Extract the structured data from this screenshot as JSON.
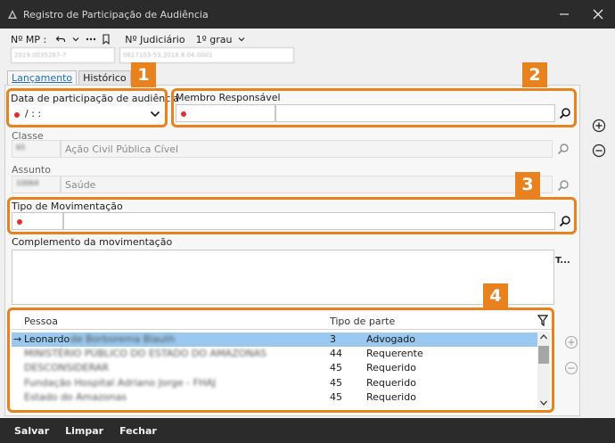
{
  "window": {
    "title": "Registro de Participação de Audiência"
  },
  "header": {
    "mp_label": "Nº MP :",
    "mp_value": "2019.0035287-7",
    "judiciario_label": "Nº Judiciário",
    "grau_label": "1º grau",
    "judiciario_value": "0617103-53.2018.8.04.0001"
  },
  "tabs": [
    "Lançamento",
    "Histórico"
  ],
  "form": {
    "data_label": "Data de participação de audiência",
    "data_value": "/     :  :",
    "membro_label": "Membro Responsável",
    "classe_label": "Classe",
    "classe_code": "65",
    "classe_value": "Ação Civil Pública Cível",
    "assunto_label": "Assunto",
    "assunto_code": "10064",
    "assunto_value": "Saúde",
    "tipo_label": "Tipo de Movimentação",
    "complemento_label": "Complemento da movimentação",
    "complemento_icon_text": "T..."
  },
  "badges": [
    "1",
    "2",
    "3",
    "4"
  ],
  "grid": {
    "columns": [
      "Pessoa",
      "Tipo de parte"
    ],
    "rows": [
      {
        "marker": "→",
        "pessoa": "Leonardo",
        "pessoa_blurred": "de Borborema Blauth",
        "code": "3",
        "tipo": "Advogado",
        "selected": true
      },
      {
        "marker": "",
        "pessoa": "",
        "pessoa_blurred": "MINISTÉRIO PÚBLICO DO ESTADO DO AMAZONAS",
        "code": "44",
        "tipo": "Requerente",
        "selected": false
      },
      {
        "marker": "",
        "pessoa": "",
        "pessoa_blurred": "DESCONSIDERAR",
        "code": "45",
        "tipo": "Requerido",
        "selected": false
      },
      {
        "marker": "",
        "pessoa": "",
        "pessoa_blurred": "Fundação Hospital Adriano Jorge - FHAJ",
        "code": "45",
        "tipo": "Requerido",
        "selected": false
      },
      {
        "marker": "",
        "pessoa": "",
        "pessoa_blurred": "Estado do Amazonas",
        "code": "45",
        "tipo": "Requerido",
        "selected": false
      }
    ]
  },
  "footer": {
    "salvar": "Salvar",
    "limpar": "Limpar",
    "fechar": "Fechar"
  },
  "colors": {
    "highlight": "#e8821e",
    "selection": "#9ac8ee",
    "dark_bar": "#2b2b2b",
    "required_dot": "#e03030"
  }
}
